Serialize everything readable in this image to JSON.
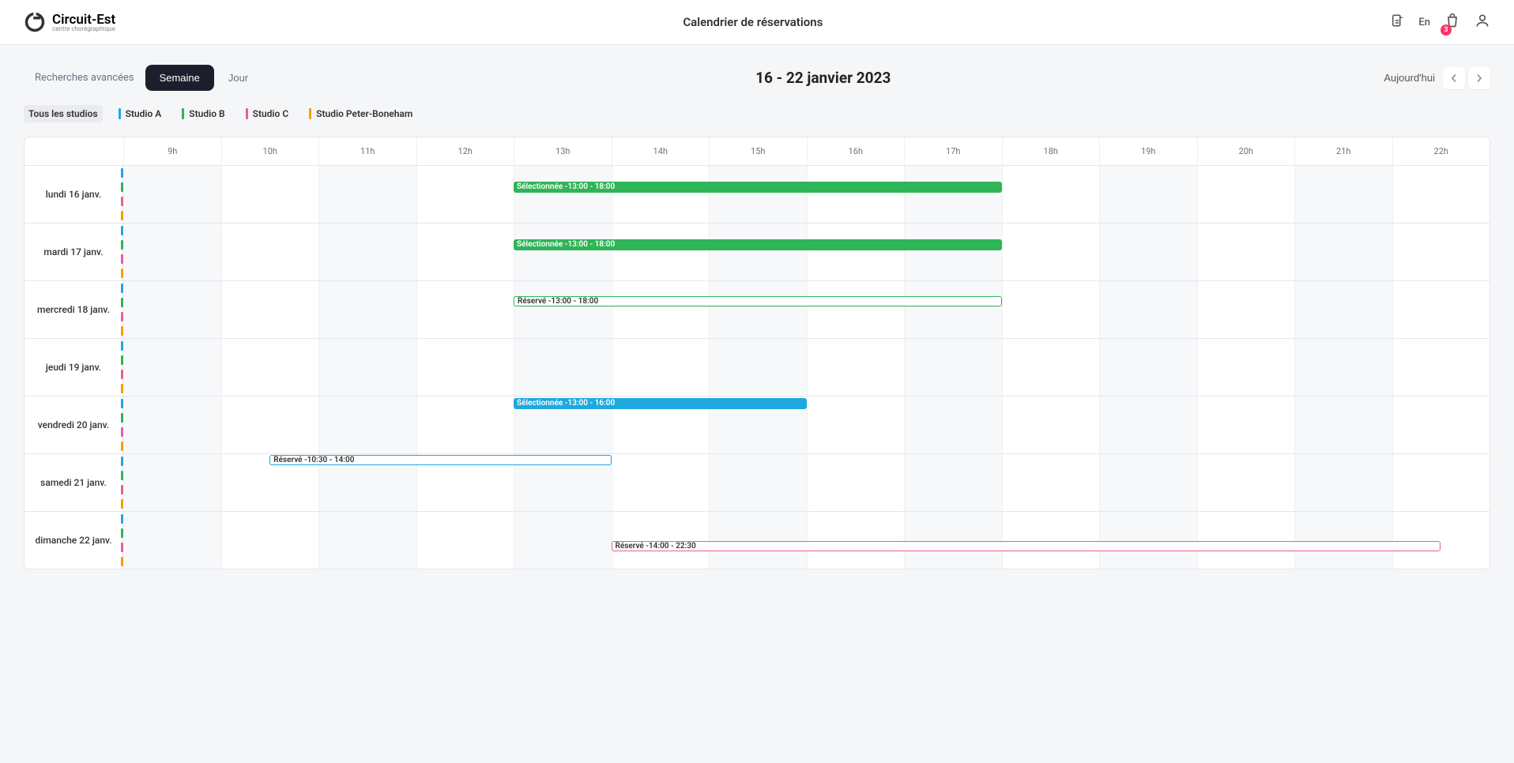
{
  "header": {
    "logo_text": "Circuit-Est",
    "logo_sub": "centre chorégraphique",
    "title": "Calendrier de réservations",
    "lang": "En",
    "cart_count": "3"
  },
  "toolbar": {
    "adv_search": "Recherches avancées",
    "week": "Semaine",
    "day": "Jour",
    "date_title": "16 - 22 janvier 2023",
    "today": "Aujourd'hui"
  },
  "filters": [
    {
      "label": "Tous les studios",
      "color": null,
      "active": true
    },
    {
      "label": "Studio A",
      "color": "#1fa8e0",
      "active": false
    },
    {
      "label": "Studio B",
      "color": "#2fb457",
      "active": false
    },
    {
      "label": "Studio C",
      "color": "#e85d9a",
      "active": false
    },
    {
      "label": "Studio Peter-Boneham",
      "color": "#f59e0b",
      "active": false
    }
  ],
  "hours": [
    "9h",
    "10h",
    "11h",
    "12h",
    "13h",
    "14h",
    "15h",
    "16h",
    "17h",
    "18h",
    "19h",
    "20h",
    "21h",
    "22h"
  ],
  "studio_colors": {
    "A": "#1fa8e0",
    "B": "#2fb457",
    "C": "#e85d9a",
    "PB": "#f59e0b"
  },
  "days": [
    {
      "label": "lundi 16 janv.",
      "tracks": [
        {
          "studio": "A",
          "events": []
        },
        {
          "studio": "B",
          "events": [
            {
              "label": "Sélectionnée -13:00 - 18:00",
              "start": 13,
              "end": 18,
              "style": "filled-green"
            }
          ]
        },
        {
          "studio": "C",
          "events": []
        },
        {
          "studio": "PB",
          "events": []
        }
      ]
    },
    {
      "label": "mardi 17 janv.",
      "tracks": [
        {
          "studio": "A",
          "events": []
        },
        {
          "studio": "B",
          "events": [
            {
              "label": "Sélectionnée -13:00 - 18:00",
              "start": 13,
              "end": 18,
              "style": "filled-green"
            }
          ]
        },
        {
          "studio": "C",
          "events": []
        },
        {
          "studio": "PB",
          "events": []
        }
      ]
    },
    {
      "label": "mercredi 18 janv.",
      "tracks": [
        {
          "studio": "A",
          "events": []
        },
        {
          "studio": "B",
          "events": [
            {
              "label": "Réservé -13:00 - 18:00",
              "start": 13,
              "end": 18,
              "style": "outline-green"
            }
          ]
        },
        {
          "studio": "C",
          "events": []
        },
        {
          "studio": "PB",
          "events": []
        }
      ]
    },
    {
      "label": "jeudi 19 janv.",
      "tracks": [
        {
          "studio": "A",
          "events": []
        },
        {
          "studio": "B",
          "events": []
        },
        {
          "studio": "C",
          "events": []
        },
        {
          "studio": "PB",
          "events": []
        }
      ]
    },
    {
      "label": "vendredi 20 janv.",
      "tracks": [
        {
          "studio": "A",
          "events": [
            {
              "label": "Sélectionnée -13:00 - 16:00",
              "start": 13,
              "end": 16,
              "style": "filled-blue"
            }
          ]
        },
        {
          "studio": "B",
          "events": []
        },
        {
          "studio": "C",
          "events": []
        },
        {
          "studio": "PB",
          "events": []
        }
      ]
    },
    {
      "label": "samedi 21 janv.",
      "tracks": [
        {
          "studio": "A",
          "events": [
            {
              "label": "Réservé -10:30 - 14:00",
              "start": 10.5,
              "end": 14,
              "style": "outline-blue"
            }
          ]
        },
        {
          "studio": "B",
          "events": []
        },
        {
          "studio": "C",
          "events": []
        },
        {
          "studio": "PB",
          "events": []
        }
      ]
    },
    {
      "label": "dimanche 22 janv.",
      "tracks": [
        {
          "studio": "A",
          "events": []
        },
        {
          "studio": "B",
          "events": []
        },
        {
          "studio": "C",
          "events": [
            {
              "label": "Réservé -14:00 - 22:30",
              "start": 14,
              "end": 22.5,
              "style": "outline-pink"
            }
          ]
        },
        {
          "studio": "PB",
          "events": []
        }
      ]
    }
  ]
}
